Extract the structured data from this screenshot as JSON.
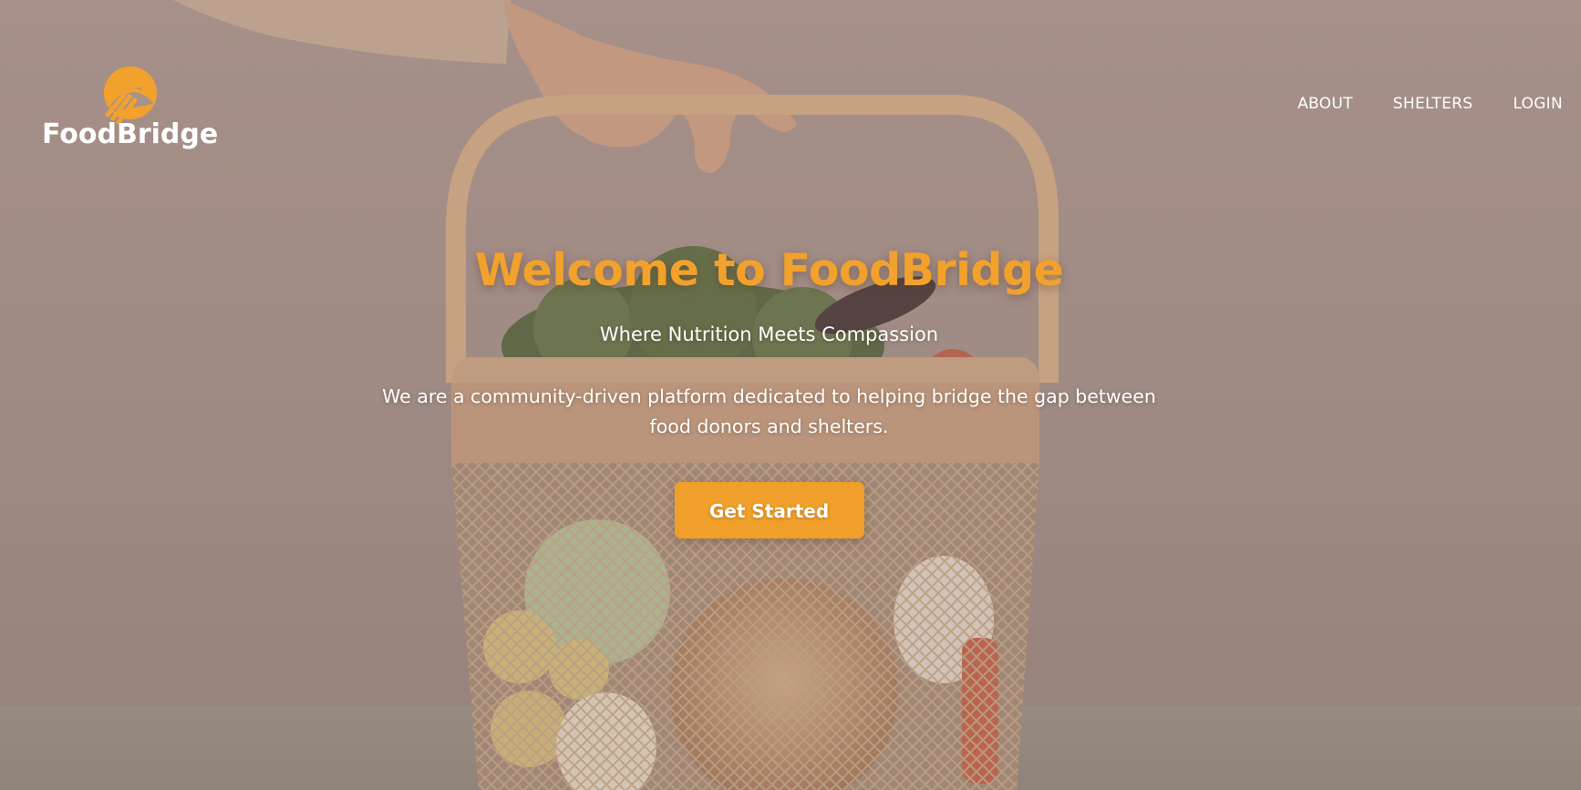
{
  "brand": {
    "name": "FoodBridge",
    "logo_icon": "sun-bridge-icon",
    "accent_color": "#f2a12d"
  },
  "nav": {
    "items": [
      {
        "label": "ABOUT"
      },
      {
        "label": "SHELTERS"
      },
      {
        "label": "LOGIN"
      }
    ]
  },
  "hero": {
    "title": "Welcome to FoodBridge",
    "subtitle": "Where Nutrition Meets Compassion",
    "description": "We are a community-driven platform dedicated to helping bridge the gap between food donors and shelters.",
    "cta_label": "Get Started",
    "cta_color": "#ef9f2a"
  },
  "background": {
    "image_subject": "hand-holding-vegetable-basket"
  }
}
